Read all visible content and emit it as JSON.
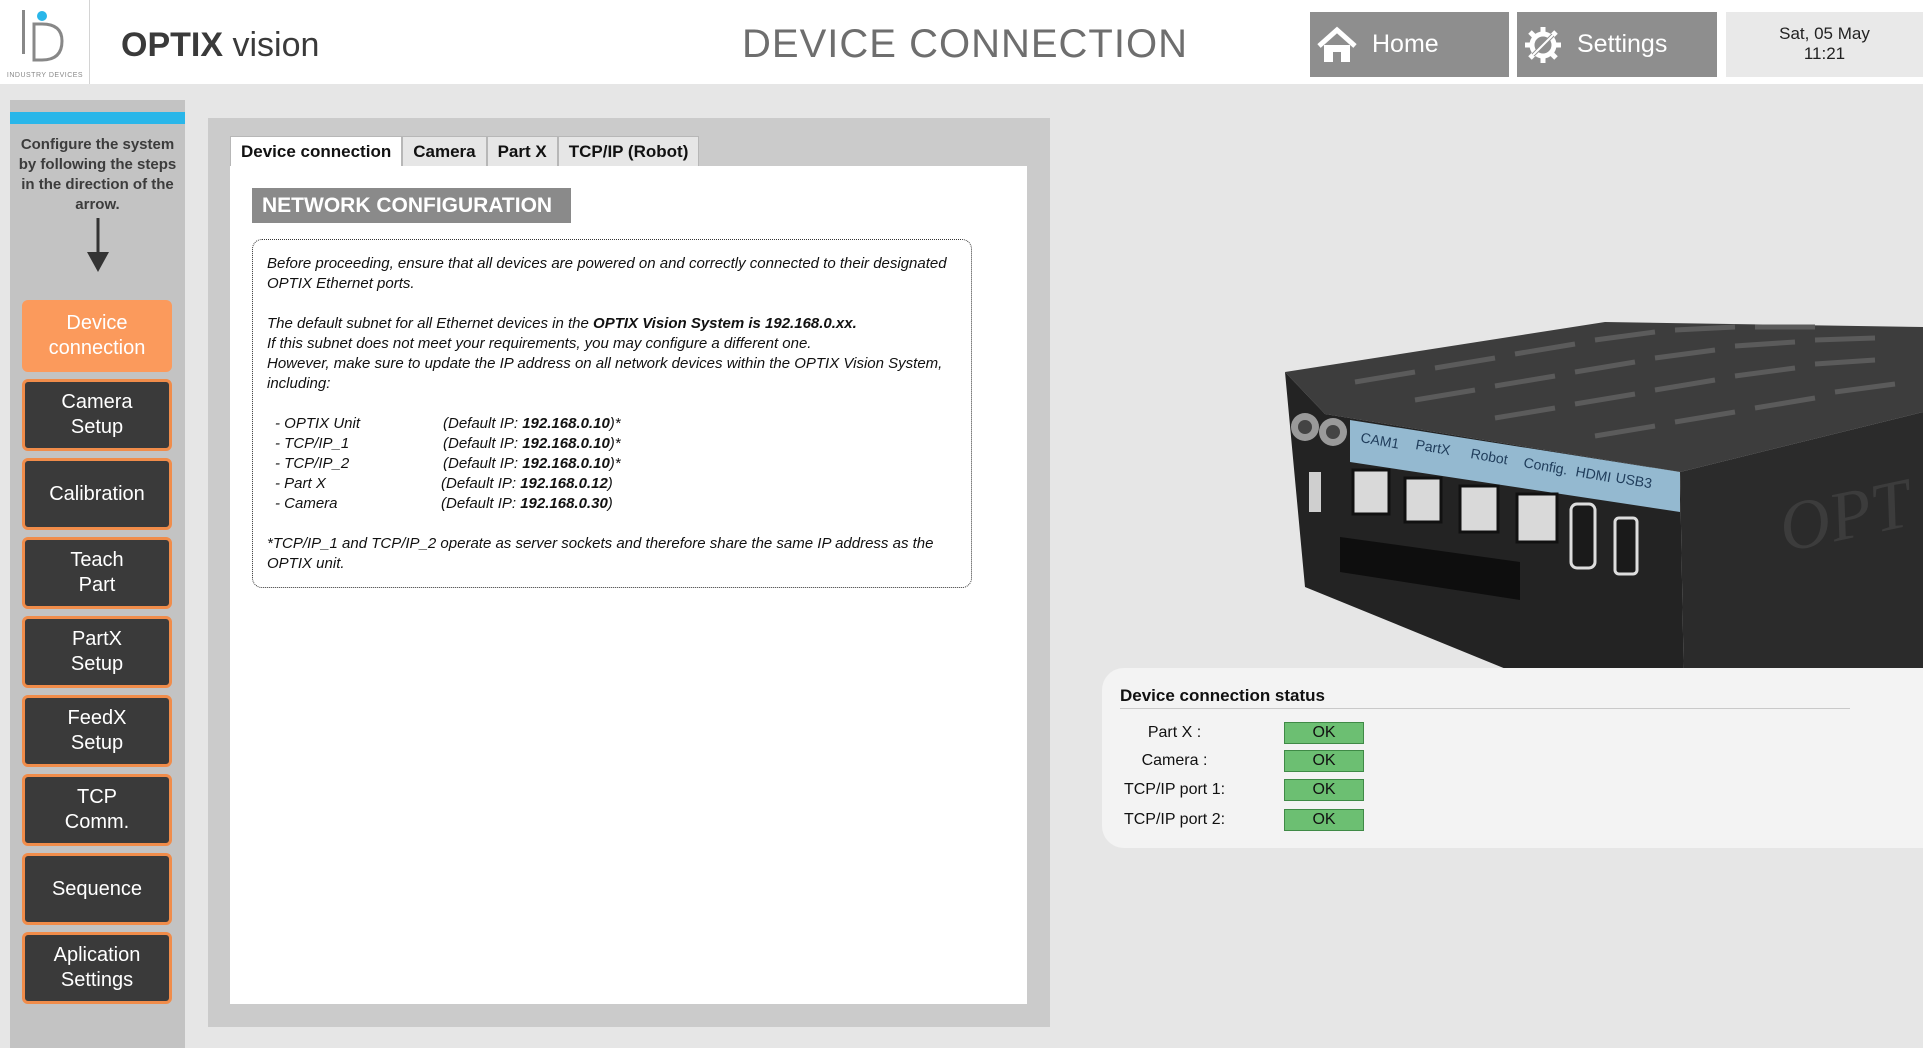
{
  "header": {
    "logo_text": "ID",
    "logo_subtext": "INDUSTRY DEVICES",
    "app_name_bold": "OPTIX",
    "app_name_rest": " vision",
    "page_title": "DEVICE CONNECTION",
    "home_label": "Home",
    "settings_label": "Settings",
    "date": "Sat, 05 May",
    "time": "11:21"
  },
  "sidebar": {
    "note": "Configure the system by following the steps in the direction of the arrow.",
    "items": [
      {
        "line1": "Device",
        "line2": "connection",
        "active": true
      },
      {
        "line1": "Camera",
        "line2": "Setup",
        "active": false
      },
      {
        "line1": "Calibration",
        "line2": "",
        "active": false
      },
      {
        "line1": "Teach",
        "line2": "Part",
        "active": false
      },
      {
        "line1": "PartX",
        "line2": "Setup",
        "active": false
      },
      {
        "line1": "FeedX",
        "line2": "Setup",
        "active": false
      },
      {
        "line1": "TCP",
        "line2": "Comm.",
        "active": false
      },
      {
        "line1": "Sequence",
        "line2": "",
        "active": false
      },
      {
        "line1": "Aplication",
        "line2": "Settings",
        "active": false
      }
    ]
  },
  "tabs": [
    "Device connection",
    "Camera",
    "Part X",
    "TCP/IP (Robot)"
  ],
  "network": {
    "title": "NETWORK CONFIGURATION",
    "para1": "Before proceeding, ensure that all devices are powered on and correctly connected to their designated OPTIX Ethernet ports.",
    "para2_prefix": "The default subnet for all Ethernet devices in the ",
    "para2_bold": "OPTIX Vision System is 192.168.0.xx.",
    "para3": "If this subnet does not meet your requirements, you may configure a different one.",
    "para4": "However, make sure to update the IP address on all network devices within the OPTIX Vision System, including:",
    "devices": [
      {
        "name": "- OPTIX Unit",
        "ip_prefix": "(Default IP: ",
        "ip": "192.168.0.10",
        "suffix": ")*"
      },
      {
        "name": "- TCP/IP_1",
        "ip_prefix": "(Default IP: ",
        "ip": "192.168.0.10",
        "suffix": ")*"
      },
      {
        "name": "- TCP/IP_2",
        "ip_prefix": "(Default IP: ",
        "ip": "192.168.0.10",
        "suffix": ")*"
      },
      {
        "name": "- Part X",
        "ip_prefix": "(Default IP: ",
        "ip": "192.168.0.12",
        "suffix": ")"
      },
      {
        "name": "- Camera",
        "ip_prefix": "(Default IP: ",
        "ip": "192.168.0.30",
        "suffix": ")"
      }
    ],
    "footnote": "*TCP/IP_1 and TCP/IP_2 operate as server sockets and therefore share the same IP address as the OPTIX unit."
  },
  "device_labels": {
    "ports": [
      "CAM1",
      "PartX",
      "Robot",
      "Config.",
      "HDMI",
      "USB3"
    ],
    "brand": "OPT"
  },
  "status": {
    "title": "Device connection status",
    "rows": [
      {
        "label": "Part X :",
        "value": "OK"
      },
      {
        "label": "Camera :",
        "value": "OK"
      },
      {
        "label": "TCP/IP port 1:",
        "value": "OK"
      },
      {
        "label": "TCP/IP port 2:",
        "value": "OK"
      }
    ],
    "ok_color": "#6cbf72"
  },
  "colors": {
    "accent_blue": "#29b6e9",
    "accent_orange": "#fb9a5c",
    "header_button": "#8e8e8e"
  }
}
